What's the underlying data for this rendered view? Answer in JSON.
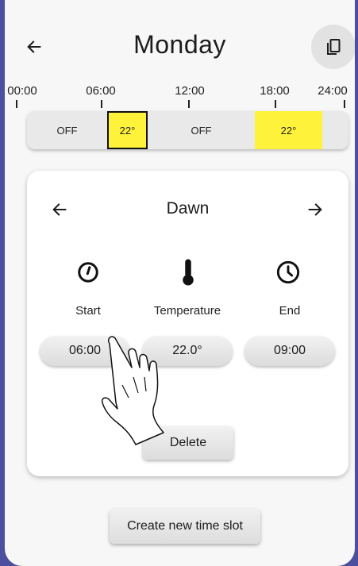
{
  "header": {
    "title": "Monday",
    "back_icon": "arrow-left-icon",
    "copy_icon": "copy-icon"
  },
  "timeline": {
    "ticks": [
      "00:00",
      "06:00",
      "12:00",
      "18:00",
      "24:00"
    ],
    "segments": [
      {
        "label": "OFF",
        "color": "#e9e9e9",
        "selected": false
      },
      {
        "label": "22°",
        "color": "#fff23a",
        "selected": true
      },
      {
        "label": "OFF",
        "color": "#e9e9e9",
        "selected": false
      },
      {
        "label": "22°",
        "color": "#fff23a",
        "selected": false
      }
    ]
  },
  "slot": {
    "name": "Dawn",
    "prev_icon": "arrow-left-icon",
    "next_icon": "arrow-right-icon",
    "start": {
      "label": "Start",
      "value": "06:00",
      "icon": "timer-icon"
    },
    "temperature": {
      "label": "Temperature",
      "value": "22.0°",
      "icon": "thermometer-icon"
    },
    "end": {
      "label": "End",
      "value": "09:00",
      "icon": "clock-icon"
    },
    "delete_label": "Delete"
  },
  "actions": {
    "create_label": "Create new time slot"
  },
  "colors": {
    "accent_yellow": "#fff23a",
    "background": "#f7f7f7",
    "frame": "#4b4f9e"
  }
}
